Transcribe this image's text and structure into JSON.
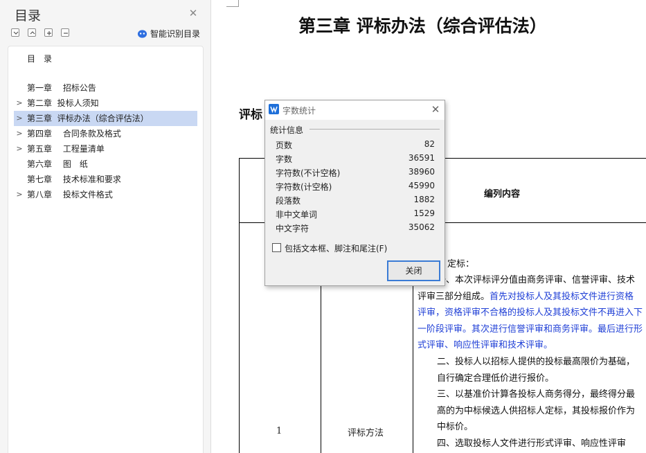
{
  "toc": {
    "title": "目录",
    "close_icon": "close-icon",
    "smart_toc_label": "智能识别目录",
    "heading": "目　录",
    "items": [
      {
        "label": "第一章　 招标公告",
        "expandable": false,
        "selected": false
      },
      {
        "label": "第二章  投标人须知",
        "expandable": true,
        "selected": false
      },
      {
        "label": "第三章  评标办法（综合评估法）",
        "expandable": true,
        "selected": true
      },
      {
        "label": "第四章　 合同条款及格式",
        "expandable": true,
        "selected": false
      },
      {
        "label": "第五章　 工程量清单",
        "expandable": true,
        "selected": false
      },
      {
        "label": "第六章　 图　纸",
        "expandable": false,
        "selected": false
      },
      {
        "label": "第七章　 技术标准和要求",
        "expandable": false,
        "selected": false
      },
      {
        "label": "第八章　 投标文件格式",
        "expandable": true,
        "selected": false
      }
    ]
  },
  "document": {
    "chapter_title": "第三章  评标办法（综合评估法）",
    "section_heading": "评标",
    "table": {
      "col_header": "编列内容",
      "row_num": "1",
      "row_method": "评标方法",
      "para_fragment": "定标：",
      "para1_start": "一、本次评标评分值由商务评审、信誉评审、技术评审三部分组成。",
      "para1_blue": "首先对投标人及其投标文件进行资格评审，资格评审不合格的投标人及其投标文件不再进入下一阶段评审。其次进行信誉评审和商务评审。最后进行形式评审、响应性评审和技术评审。",
      "para2": "二、投标人以招标人提供的投标最高限价为基础，自行确定合理低价进行报价。",
      "para3": "三、以基准价计算各投标人商务得分，最终得分最高的为中标候选人供招标人定标，其投标报价作为中标价。",
      "para4": "四、选取投标人文件进行形式评审、响应性评审"
    }
  },
  "word_count_dialog": {
    "title": "字数统计",
    "section_label": "统计信息",
    "rows": [
      {
        "label": "页数",
        "value": "82"
      },
      {
        "label": "字数",
        "value": "36591"
      },
      {
        "label": "字符数(不计空格)",
        "value": "38960"
      },
      {
        "label": "字符数(计空格)",
        "value": "45990"
      },
      {
        "label": "段落数",
        "value": "1882"
      },
      {
        "label": "非中文单词",
        "value": "1529"
      },
      {
        "label": "中文字符",
        "value": "35062"
      }
    ],
    "checkbox_label": "包括文本框、脚注和尾注(F)",
    "checkbox_checked": false,
    "close_button": "关闭"
  },
  "colors": {
    "selection": "#c9d8f3",
    "blue_text": "#1f3fd6",
    "button_border": "#3a7bd5"
  }
}
